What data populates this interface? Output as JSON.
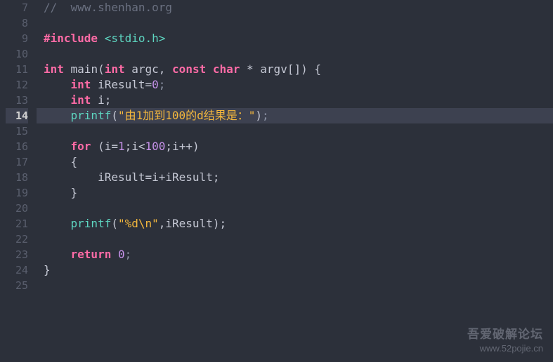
{
  "lines": [
    {
      "num": "7"
    },
    {
      "num": "8"
    },
    {
      "num": "9"
    },
    {
      "num": "10"
    },
    {
      "num": "11"
    },
    {
      "num": "12"
    },
    {
      "num": "13"
    },
    {
      "num": "14"
    },
    {
      "num": "15"
    },
    {
      "num": "16"
    },
    {
      "num": "17"
    },
    {
      "num": "18"
    },
    {
      "num": "19"
    },
    {
      "num": "20"
    },
    {
      "num": "21"
    },
    {
      "num": "22"
    },
    {
      "num": "23"
    },
    {
      "num": "24"
    },
    {
      "num": "25"
    }
  ],
  "code": {
    "comment_url": "//  www.shenhan.org",
    "include_directive": "#include",
    "include_path": " <stdio.h>",
    "int_kw": "int",
    "main_fn": " main(",
    "argc": " argc, ",
    "const_kw": "const",
    "char_kw": "char",
    "argv": " * argv[]) {",
    "iresult_decl": " iResult=",
    "zero": "0",
    "semi": ";",
    "i_decl": " i;",
    "printf_fn": "printf",
    "lparen": "(",
    "rparen": ")",
    "str1": "\"由1加到100的d结果是：\"",
    "for_kw": "for",
    "for_cond_a": " (i=",
    "one": "1",
    "for_cond_b": ";i<",
    "hundred": "100",
    "for_cond_c": ";i++)",
    "lbrace": "{",
    "rbrace": "}",
    "iresult_assign": "iResult=i+iResult;",
    "str2": "\"%d\\n\"",
    "printf2_args": ",iResult);",
    "return_kw": "return",
    "space": " ",
    "return_val": "0"
  },
  "watermark": {
    "cn": "吾爱破解论坛",
    "url": "www.52pojie.cn"
  }
}
